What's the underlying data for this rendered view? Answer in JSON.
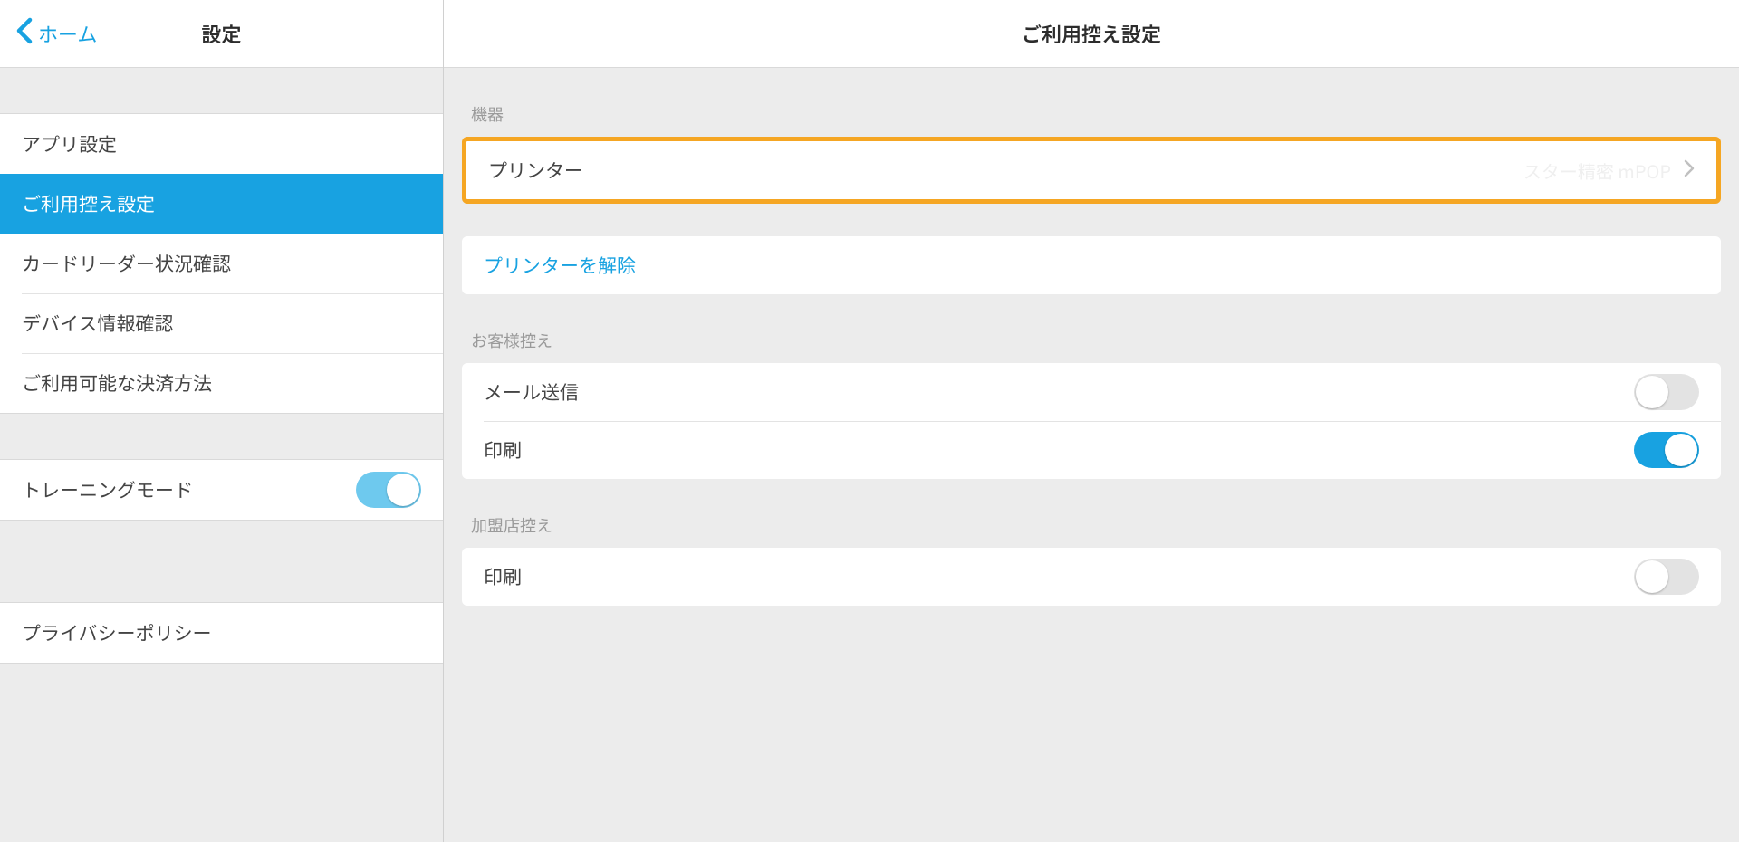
{
  "sidebar": {
    "back_label": "ホーム",
    "title": "設定",
    "group1": [
      {
        "label": "アプリ設定"
      },
      {
        "label": "ご利用控え設定",
        "selected": true
      },
      {
        "label": "カードリーダー状況確認"
      },
      {
        "label": "デバイス情報確認"
      },
      {
        "label": "ご利用可能な決済方法"
      }
    ],
    "training_mode": {
      "label": "トレーニングモード",
      "on": true
    },
    "privacy": {
      "label": "プライバシーポリシー"
    }
  },
  "main": {
    "title": "ご利用控え設定",
    "device_section": {
      "label": "機器",
      "printer_row": {
        "label": "プリンター",
        "value": "スター精密 mPOP"
      },
      "unlink_label": "プリンターを解除"
    },
    "customer_section": {
      "label": "お客様控え",
      "rows": [
        {
          "label": "メール送信",
          "on": false
        },
        {
          "label": "印刷",
          "on": true
        }
      ]
    },
    "merchant_section": {
      "label": "加盟店控え",
      "rows": [
        {
          "label": "印刷",
          "on": false
        }
      ]
    }
  }
}
